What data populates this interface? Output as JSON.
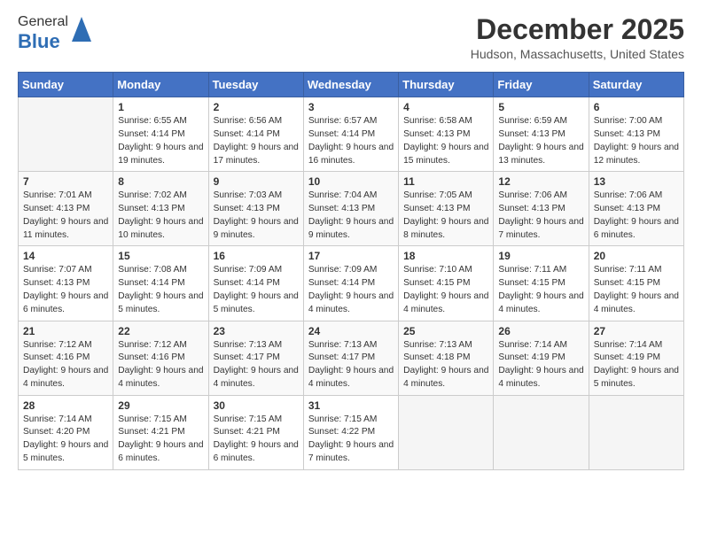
{
  "header": {
    "logo_general": "General",
    "logo_blue": "Blue",
    "month": "December 2025",
    "location": "Hudson, Massachusetts, United States"
  },
  "days_of_week": [
    "Sunday",
    "Monday",
    "Tuesday",
    "Wednesday",
    "Thursday",
    "Friday",
    "Saturday"
  ],
  "weeks": [
    [
      {
        "day": "",
        "empty": true
      },
      {
        "day": "1",
        "sunrise": "Sunrise: 6:55 AM",
        "sunset": "Sunset: 4:14 PM",
        "daylight": "Daylight: 9 hours and 19 minutes."
      },
      {
        "day": "2",
        "sunrise": "Sunrise: 6:56 AM",
        "sunset": "Sunset: 4:14 PM",
        "daylight": "Daylight: 9 hours and 17 minutes."
      },
      {
        "day": "3",
        "sunrise": "Sunrise: 6:57 AM",
        "sunset": "Sunset: 4:14 PM",
        "daylight": "Daylight: 9 hours and 16 minutes."
      },
      {
        "day": "4",
        "sunrise": "Sunrise: 6:58 AM",
        "sunset": "Sunset: 4:13 PM",
        "daylight": "Daylight: 9 hours and 15 minutes."
      },
      {
        "day": "5",
        "sunrise": "Sunrise: 6:59 AM",
        "sunset": "Sunset: 4:13 PM",
        "daylight": "Daylight: 9 hours and 13 minutes."
      },
      {
        "day": "6",
        "sunrise": "Sunrise: 7:00 AM",
        "sunset": "Sunset: 4:13 PM",
        "daylight": "Daylight: 9 hours and 12 minutes."
      }
    ],
    [
      {
        "day": "7",
        "sunrise": "Sunrise: 7:01 AM",
        "sunset": "Sunset: 4:13 PM",
        "daylight": "Daylight: 9 hours and 11 minutes."
      },
      {
        "day": "8",
        "sunrise": "Sunrise: 7:02 AM",
        "sunset": "Sunset: 4:13 PM",
        "daylight": "Daylight: 9 hours and 10 minutes."
      },
      {
        "day": "9",
        "sunrise": "Sunrise: 7:03 AM",
        "sunset": "Sunset: 4:13 PM",
        "daylight": "Daylight: 9 hours and 9 minutes."
      },
      {
        "day": "10",
        "sunrise": "Sunrise: 7:04 AM",
        "sunset": "Sunset: 4:13 PM",
        "daylight": "Daylight: 9 hours and 9 minutes."
      },
      {
        "day": "11",
        "sunrise": "Sunrise: 7:05 AM",
        "sunset": "Sunset: 4:13 PM",
        "daylight": "Daylight: 9 hours and 8 minutes."
      },
      {
        "day": "12",
        "sunrise": "Sunrise: 7:06 AM",
        "sunset": "Sunset: 4:13 PM",
        "daylight": "Daylight: 9 hours and 7 minutes."
      },
      {
        "day": "13",
        "sunrise": "Sunrise: 7:06 AM",
        "sunset": "Sunset: 4:13 PM",
        "daylight": "Daylight: 9 hours and 6 minutes."
      }
    ],
    [
      {
        "day": "14",
        "sunrise": "Sunrise: 7:07 AM",
        "sunset": "Sunset: 4:13 PM",
        "daylight": "Daylight: 9 hours and 6 minutes."
      },
      {
        "day": "15",
        "sunrise": "Sunrise: 7:08 AM",
        "sunset": "Sunset: 4:14 PM",
        "daylight": "Daylight: 9 hours and 5 minutes."
      },
      {
        "day": "16",
        "sunrise": "Sunrise: 7:09 AM",
        "sunset": "Sunset: 4:14 PM",
        "daylight": "Daylight: 9 hours and 5 minutes."
      },
      {
        "day": "17",
        "sunrise": "Sunrise: 7:09 AM",
        "sunset": "Sunset: 4:14 PM",
        "daylight": "Daylight: 9 hours and 4 minutes."
      },
      {
        "day": "18",
        "sunrise": "Sunrise: 7:10 AM",
        "sunset": "Sunset: 4:15 PM",
        "daylight": "Daylight: 9 hours and 4 minutes."
      },
      {
        "day": "19",
        "sunrise": "Sunrise: 7:11 AM",
        "sunset": "Sunset: 4:15 PM",
        "daylight": "Daylight: 9 hours and 4 minutes."
      },
      {
        "day": "20",
        "sunrise": "Sunrise: 7:11 AM",
        "sunset": "Sunset: 4:15 PM",
        "daylight": "Daylight: 9 hours and 4 minutes."
      }
    ],
    [
      {
        "day": "21",
        "sunrise": "Sunrise: 7:12 AM",
        "sunset": "Sunset: 4:16 PM",
        "daylight": "Daylight: 9 hours and 4 minutes."
      },
      {
        "day": "22",
        "sunrise": "Sunrise: 7:12 AM",
        "sunset": "Sunset: 4:16 PM",
        "daylight": "Daylight: 9 hours and 4 minutes."
      },
      {
        "day": "23",
        "sunrise": "Sunrise: 7:13 AM",
        "sunset": "Sunset: 4:17 PM",
        "daylight": "Daylight: 9 hours and 4 minutes."
      },
      {
        "day": "24",
        "sunrise": "Sunrise: 7:13 AM",
        "sunset": "Sunset: 4:17 PM",
        "daylight": "Daylight: 9 hours and 4 minutes."
      },
      {
        "day": "25",
        "sunrise": "Sunrise: 7:13 AM",
        "sunset": "Sunset: 4:18 PM",
        "daylight": "Daylight: 9 hours and 4 minutes."
      },
      {
        "day": "26",
        "sunrise": "Sunrise: 7:14 AM",
        "sunset": "Sunset: 4:19 PM",
        "daylight": "Daylight: 9 hours and 4 minutes."
      },
      {
        "day": "27",
        "sunrise": "Sunrise: 7:14 AM",
        "sunset": "Sunset: 4:19 PM",
        "daylight": "Daylight: 9 hours and 5 minutes."
      }
    ],
    [
      {
        "day": "28",
        "sunrise": "Sunrise: 7:14 AM",
        "sunset": "Sunset: 4:20 PM",
        "daylight": "Daylight: 9 hours and 5 minutes."
      },
      {
        "day": "29",
        "sunrise": "Sunrise: 7:15 AM",
        "sunset": "Sunset: 4:21 PM",
        "daylight": "Daylight: 9 hours and 6 minutes."
      },
      {
        "day": "30",
        "sunrise": "Sunrise: 7:15 AM",
        "sunset": "Sunset: 4:21 PM",
        "daylight": "Daylight: 9 hours and 6 minutes."
      },
      {
        "day": "31",
        "sunrise": "Sunrise: 7:15 AM",
        "sunset": "Sunset: 4:22 PM",
        "daylight": "Daylight: 9 hours and 7 minutes."
      },
      {
        "day": "",
        "empty": true
      },
      {
        "day": "",
        "empty": true
      },
      {
        "day": "",
        "empty": true
      }
    ]
  ]
}
